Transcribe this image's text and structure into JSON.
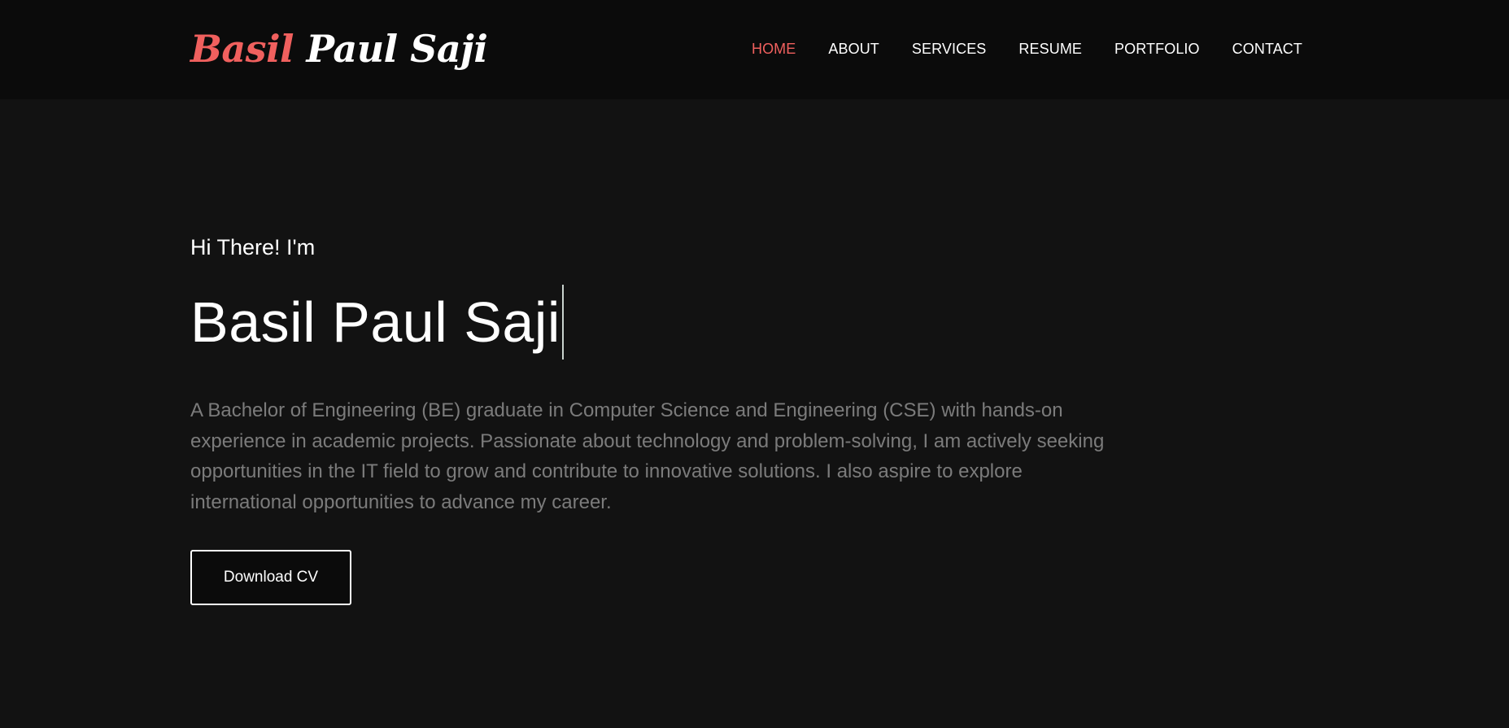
{
  "brand": {
    "first": "Basil",
    "rest": " Paul Saji"
  },
  "nav": {
    "items": [
      {
        "label": "HOME",
        "active": true
      },
      {
        "label": "ABOUT",
        "active": false
      },
      {
        "label": "SERVICES",
        "active": false
      },
      {
        "label": "RESUME",
        "active": false
      },
      {
        "label": "PORTFOLIO",
        "active": false
      },
      {
        "label": "CONTACT",
        "active": false
      }
    ]
  },
  "hero": {
    "greeting": "Hi There! I'm",
    "name": "Basil Paul Saji",
    "bio": "A Bachelor of Engineering (BE) graduate in Computer Science and Engineering (CSE) with hands-on experience in academic projects. Passionate about technology and problem-solving, I am actively seeking opportunities in the IT field to grow and contribute to innovative solutions. I also aspire to explore international opportunities to advance my career.",
    "cv_button": "Download CV"
  },
  "colors": {
    "accent": "#f0605e",
    "background": "#121212",
    "navbar": "#0b0b0b",
    "body_text": "#7b7b7b"
  }
}
